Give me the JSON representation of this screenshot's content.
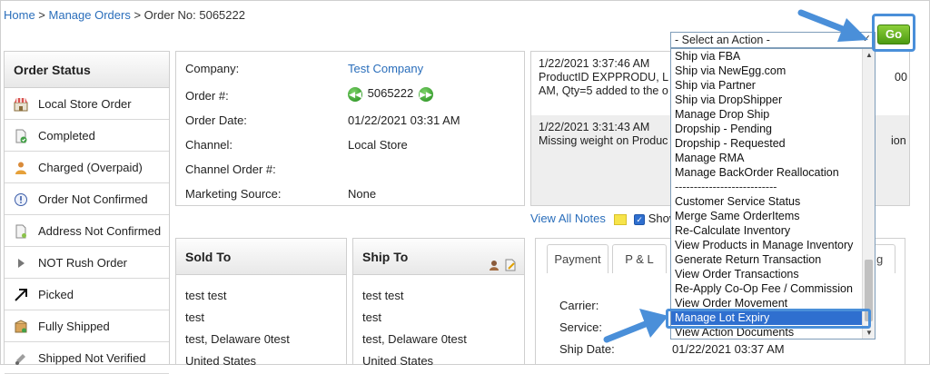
{
  "breadcrumb": {
    "home": "Home",
    "sep1": " > ",
    "manage_orders": "Manage Orders",
    "sep2": " > ",
    "current": "Order No: 5065222"
  },
  "action": {
    "select_value": "- Select an Action -",
    "go_label": "Go",
    "options": [
      "Ship via FBA",
      "Ship via NewEgg.com",
      "Ship via Partner",
      "Ship via DropShipper",
      "Manage Drop Ship",
      "Dropship - Pending",
      "Dropship - Requested",
      "Manage RMA",
      "Manage BackOrder Reallocation",
      "---------------------------",
      "Customer Service Status",
      "Merge Same OrderItems",
      "Re-Calculate Inventory",
      "View Products in Manage Inventory",
      "Generate Return Transaction",
      "View Order Transactions",
      "Re-Apply Co-Op Fee / Commission",
      "View Order Movement",
      "Manage Lot Expiry",
      "View Action Documents"
    ],
    "selected_index": 18
  },
  "status": {
    "title": "Order Status",
    "items": [
      {
        "label": "Local Store Order",
        "icon": "store-icon"
      },
      {
        "label": "Completed",
        "icon": "document-check-icon"
      },
      {
        "label": "Charged (Overpaid)",
        "icon": "person-icon"
      },
      {
        "label": "Order Not Confirmed",
        "icon": "info-circle-icon"
      },
      {
        "label": "Address Not Confirmed",
        "icon": "document-icon"
      },
      {
        "label": "NOT Rush Order",
        "icon": "play-triangle-icon"
      },
      {
        "label": "Picked",
        "icon": "arrow-up-right-icon"
      },
      {
        "label": "Fully Shipped",
        "icon": "box-icon"
      },
      {
        "label": "Shipped Not Verified",
        "icon": "truck-icon"
      }
    ]
  },
  "info": {
    "company_label": "Company:",
    "company_value": "Test Company",
    "order_label": "Order #:",
    "order_value": "5065222",
    "date_label": "Order Date:",
    "date_value": "01/22/2021 03:31 AM",
    "channel_label": "Channel:",
    "channel_value": "Local Store",
    "channel_order_label": "Channel Order #:",
    "channel_order_value": "",
    "marketing_label": "Marketing Source:",
    "marketing_value": "None"
  },
  "notes": {
    "note1_time": "1/22/2021 3:37:46 AM",
    "note1_line1": "ProductID EXPPRODU, L",
    "note1_line2": "AM, Qty=5 added to the o",
    "note1_tail": "00",
    "note2_time": "1/22/2021 3:31:43 AM",
    "note2_line1": "Missing weight on Produc",
    "note2_tail": "ion",
    "view_all": "View All Notes",
    "show_label": "Show"
  },
  "sold_to": {
    "title": "Sold To",
    "lines": [
      "test test",
      "test",
      "test, Delaware 0test",
      "United States"
    ]
  },
  "ship_to": {
    "title": "Ship To",
    "lines": [
      "test test",
      "test",
      "test, Delaware 0test",
      "United States"
    ]
  },
  "tabs": {
    "items": [
      "Payment",
      "P & L"
    ],
    "partial_tab_tail": "g"
  },
  "shipping": {
    "carrier_label": "Carrier:",
    "service_label": "Service:",
    "ship_date_label": "Ship Date:",
    "ship_date_value": "01/22/2021 03:37 AM"
  },
  "colors": {
    "link": "#2a6ebb",
    "go_green": "#4c9a12",
    "highlight_blue": "#4a8fd9",
    "selected_option": "#2f6fcf"
  }
}
